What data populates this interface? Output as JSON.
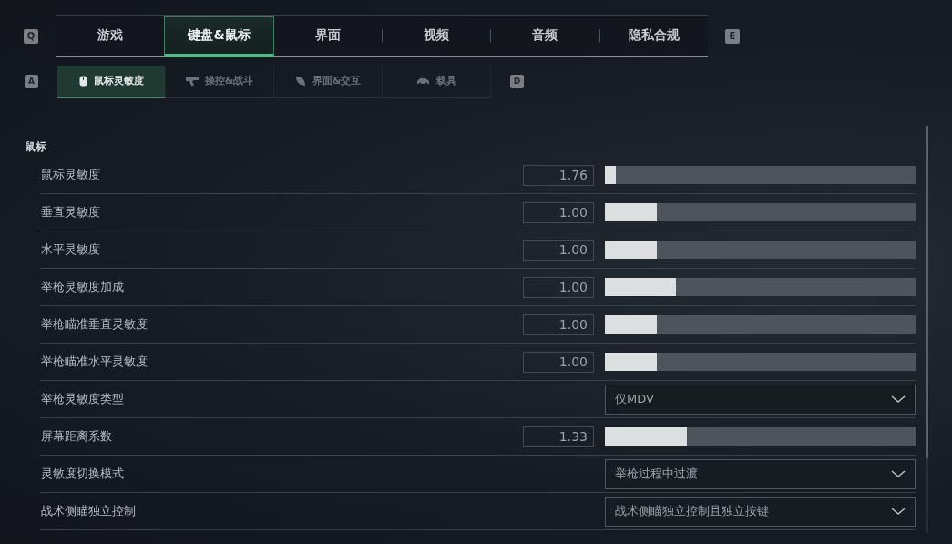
{
  "tabs_prev_key": "Q",
  "tabs": [
    {
      "label": "游戏",
      "selected": false
    },
    {
      "label": "键盘&鼠标",
      "selected": true
    },
    {
      "label": "界面",
      "selected": false
    },
    {
      "label": "视频",
      "selected": false
    },
    {
      "label": "音频",
      "selected": false
    },
    {
      "label": "隐私合规",
      "selected": false
    }
  ],
  "tabs_next_key": "E",
  "subtabs_prev_key": "A",
  "subtabs": [
    {
      "label": "鼠标灵敏度",
      "selected": true
    },
    {
      "label": "操控&战斗",
      "selected": false
    },
    {
      "label": "界面&交互",
      "selected": false
    },
    {
      "label": "载具",
      "selected": false
    }
  ],
  "subtabs_next_key": "D",
  "section": {
    "title": "鼠标",
    "rows": [
      {
        "kind": "slider",
        "label": "鼠标灵敏度",
        "value": "1.76",
        "level": 0.035
      },
      {
        "kind": "slider",
        "label": "垂直灵敏度",
        "value": "1.00",
        "level": 0.167
      },
      {
        "kind": "slider",
        "label": "水平灵敏度",
        "value": "1.00",
        "level": 0.167
      },
      {
        "kind": "slider",
        "label": "举枪灵敏度加成",
        "value": "1.00",
        "level": 0.23
      },
      {
        "kind": "slider",
        "label": "举枪瞄准垂直灵敏度",
        "value": "1.00",
        "level": 0.167
      },
      {
        "kind": "slider",
        "label": "举枪瞄准水平灵敏度",
        "value": "1.00",
        "level": 0.167
      },
      {
        "kind": "dropdown",
        "label": "举枪灵敏度类型",
        "value": "仅MDV"
      },
      {
        "kind": "slider",
        "label": "屏幕距离系数",
        "value": "1.33",
        "level": 0.264
      },
      {
        "kind": "dropdown",
        "label": "灵敏度切换模式",
        "value": "举枪过程中过渡"
      },
      {
        "kind": "dropdown",
        "label": "战术侧瞄独立控制",
        "value": "战术侧瞄独立控制且独立按键"
      }
    ]
  }
}
